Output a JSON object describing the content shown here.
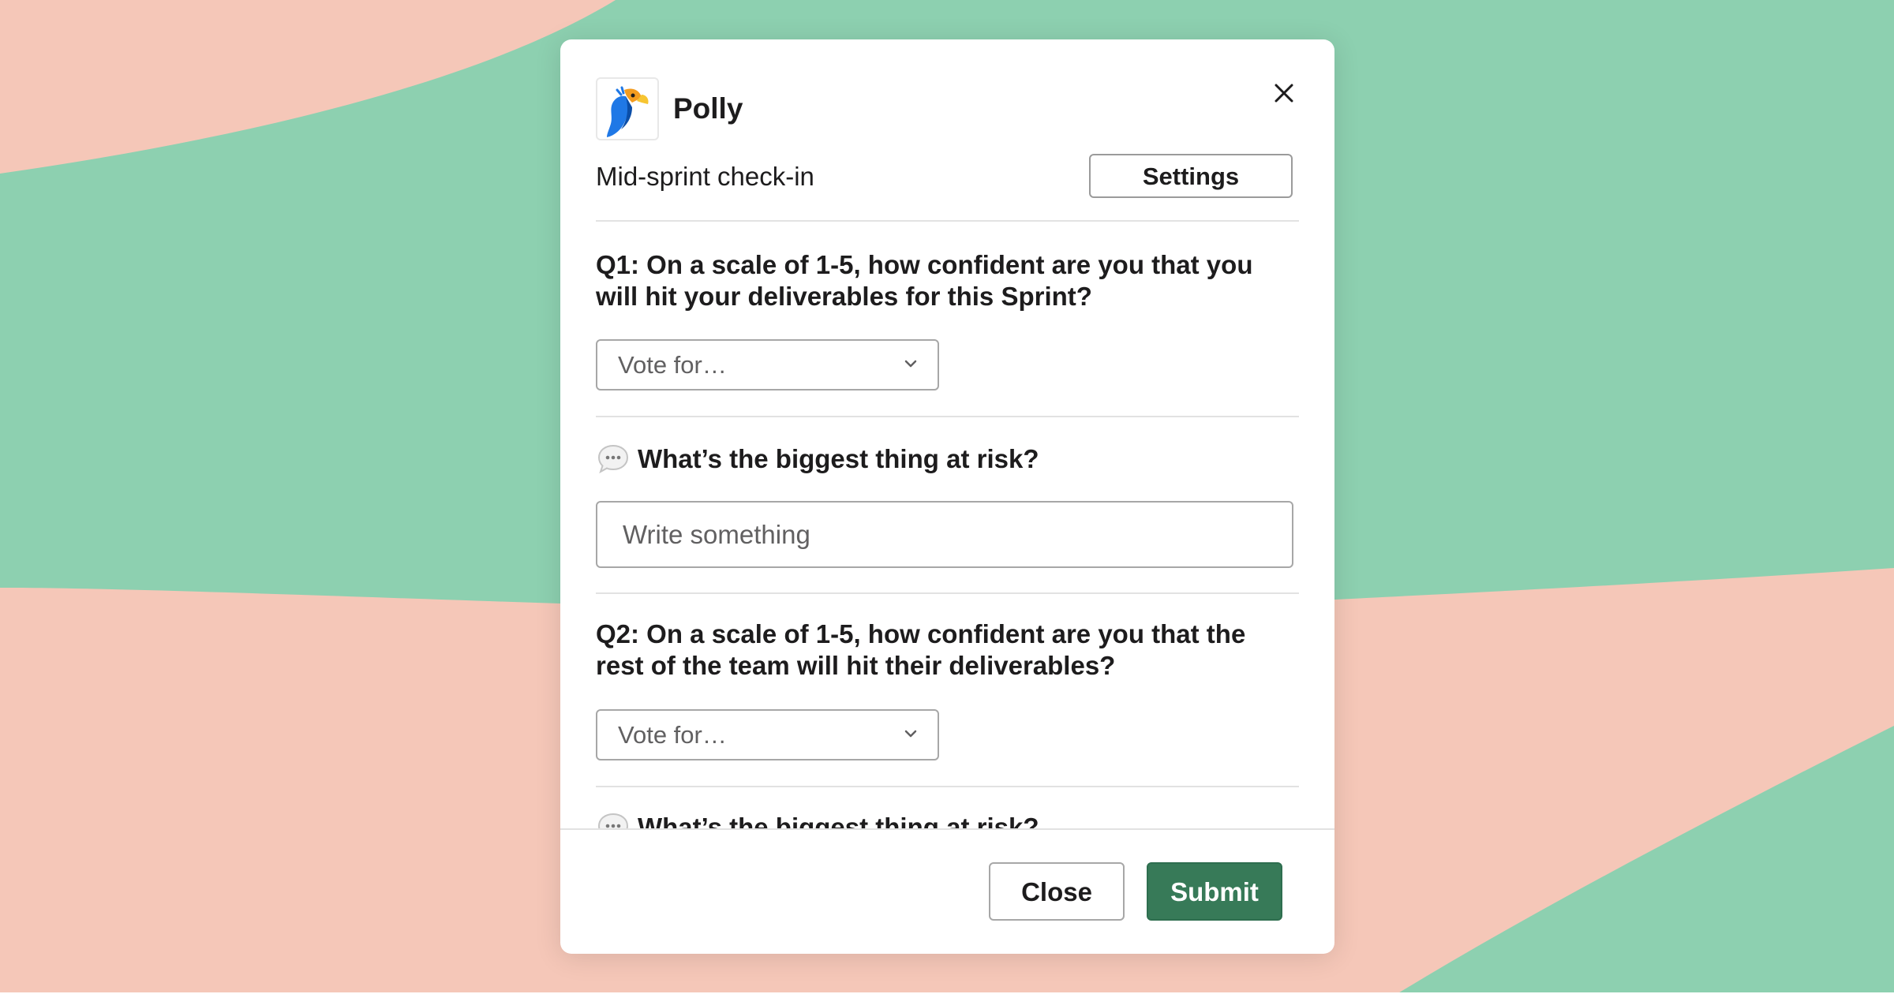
{
  "colors": {
    "background_green": "#8dd0b0",
    "background_peach": "#f5c7b8",
    "submit_green": "#377a58"
  },
  "modal": {
    "app_icon": "parrot-logo-icon",
    "app_name": "Polly",
    "close_icon": "close-icon",
    "subtitle": "Mid-sprint check-in",
    "settings_label": "Settings",
    "questions": [
      {
        "text": "Q1: On a scale of 1-5, how confident are you that you will hit your deliverables for this Sprint?",
        "select_value": "Vote for…"
      },
      {
        "text": "Q2: On a scale of 1-5, how confident are you that the rest of the team will hit their deliverables?",
        "select_value": "Vote for…"
      }
    ],
    "comment_prompts": [
      {
        "icon": "speech-bubble-icon",
        "text": "What’s the biggest thing at risk?"
      },
      {
        "icon": "speech-bubble-icon",
        "text": "What’s the biggest thing at risk?"
      }
    ],
    "text_input_placeholder": "Write something",
    "footer": {
      "close_label": "Close",
      "submit_label": "Submit"
    }
  }
}
